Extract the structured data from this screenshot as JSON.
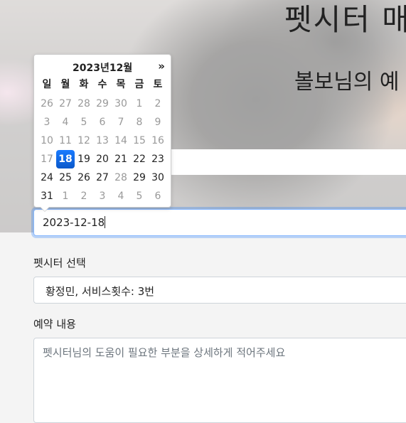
{
  "hero": {
    "title": "펫시터 매",
    "subtitle": "볼보님의 예"
  },
  "datepicker": {
    "header": "2023년12월",
    "next_label": "»",
    "weekdays": [
      "일",
      "월",
      "화",
      "수",
      "목",
      "금",
      "토"
    ],
    "weeks": [
      [
        {
          "d": "26",
          "muted": true
        },
        {
          "d": "27",
          "muted": true
        },
        {
          "d": "28",
          "muted": true
        },
        {
          "d": "29",
          "muted": true
        },
        {
          "d": "30",
          "muted": true
        },
        {
          "d": "1",
          "muted": true
        },
        {
          "d": "2",
          "muted": true
        }
      ],
      [
        {
          "d": "3",
          "muted": true
        },
        {
          "d": "4",
          "muted": true
        },
        {
          "d": "5",
          "muted": true
        },
        {
          "d": "6",
          "muted": true
        },
        {
          "d": "7",
          "muted": true
        },
        {
          "d": "8",
          "muted": true
        },
        {
          "d": "9",
          "muted": true
        }
      ],
      [
        {
          "d": "10",
          "muted": true
        },
        {
          "d": "11",
          "muted": true
        },
        {
          "d": "12",
          "muted": true
        },
        {
          "d": "13",
          "muted": true
        },
        {
          "d": "14",
          "muted": true
        },
        {
          "d": "15",
          "muted": true
        },
        {
          "d": "16",
          "muted": true
        }
      ],
      [
        {
          "d": "17",
          "muted": true
        },
        {
          "d": "18",
          "selected": true
        },
        {
          "d": "19"
        },
        {
          "d": "20"
        },
        {
          "d": "21"
        },
        {
          "d": "22"
        },
        {
          "d": "23"
        }
      ],
      [
        {
          "d": "24"
        },
        {
          "d": "25"
        },
        {
          "d": "26"
        },
        {
          "d": "27"
        },
        {
          "d": "28",
          "muted": true
        },
        {
          "d": "29"
        },
        {
          "d": "30"
        }
      ],
      [
        {
          "d": "31"
        },
        {
          "d": "1",
          "muted": true
        },
        {
          "d": "2",
          "muted": true
        },
        {
          "d": "3",
          "muted": true
        },
        {
          "d": "4",
          "muted": true
        },
        {
          "d": "5",
          "muted": true
        },
        {
          "d": "6",
          "muted": true
        }
      ]
    ]
  },
  "form": {
    "date_value": "2023-12-18",
    "sitter_label": "펫시터 선택",
    "sitter_value": "황정민, 서비스횟수: 3번",
    "content_label": "예약 내용",
    "content_placeholder": "펫시터님의 도움이 필요한 부분을 상세하게 적어주세요"
  },
  "colors": {
    "accent": "#0d6efd",
    "focus_border": "#86b7fe"
  }
}
